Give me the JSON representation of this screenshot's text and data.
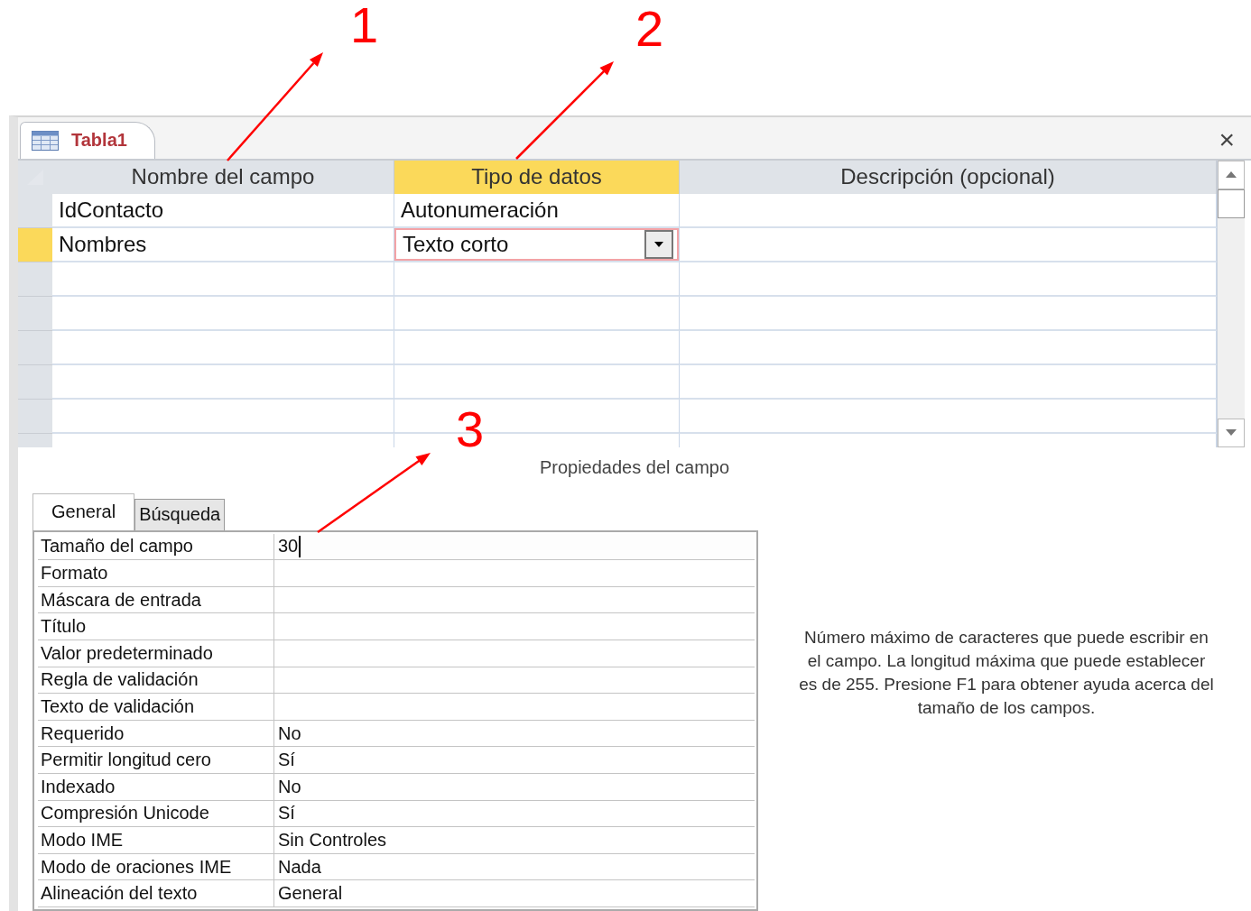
{
  "document_tab": {
    "title": "Tabla1",
    "close_glyph": "×"
  },
  "grid": {
    "columns": [
      {
        "label": "Nombre del campo",
        "selected": false
      },
      {
        "label": "Tipo de datos",
        "selected": true
      },
      {
        "label": "Descripción (opcional)",
        "selected": false
      }
    ],
    "rows": [
      {
        "name": "IdContacto",
        "type": "Autonumeración",
        "selected": false
      },
      {
        "name": "Nombres",
        "type": "Texto corto",
        "selected": true
      }
    ]
  },
  "properties_title": "Propiedades del campo",
  "property_tabs": [
    {
      "label": "General",
      "selected": true
    },
    {
      "label": "Búsqueda",
      "selected": false
    }
  ],
  "properties": [
    {
      "label": "Tamaño del campo",
      "value": "30",
      "active": true
    },
    {
      "label": "Formato",
      "active": false
    },
    {
      "label": "Máscara de entrada",
      "active": false
    },
    {
      "label": "Título",
      "active": false
    },
    {
      "label": "Valor predeterminado",
      "active": false
    },
    {
      "label": "Regla de validación",
      "active": false
    },
    {
      "label": "Texto de validación",
      "active": false
    },
    {
      "label": "Requerido",
      "value": "No",
      "active": false
    },
    {
      "label": "Permitir longitud cero",
      "value": "Sí",
      "active": false
    },
    {
      "label": "Indexado",
      "value": "No",
      "active": false
    },
    {
      "label": "Compresión Unicode",
      "value": "Sí",
      "active": false
    },
    {
      "label": "Modo IME",
      "value": "Sin Controles",
      "active": false
    },
    {
      "label": "Modo de oraciones IME",
      "value": "Nada",
      "active": false
    },
    {
      "label": "Alineación del texto",
      "value": "General",
      "active": false
    }
  ],
  "help_text": "Número máximo de caracteres que puede escribir en el campo. La longitud máxima que puede establecer es de 255. Presione F1 para obtener ayuda acerca del tamaño de los campos.",
  "annotations": [
    {
      "label": "1"
    },
    {
      "label": "2"
    },
    {
      "label": "3"
    }
  ]
}
